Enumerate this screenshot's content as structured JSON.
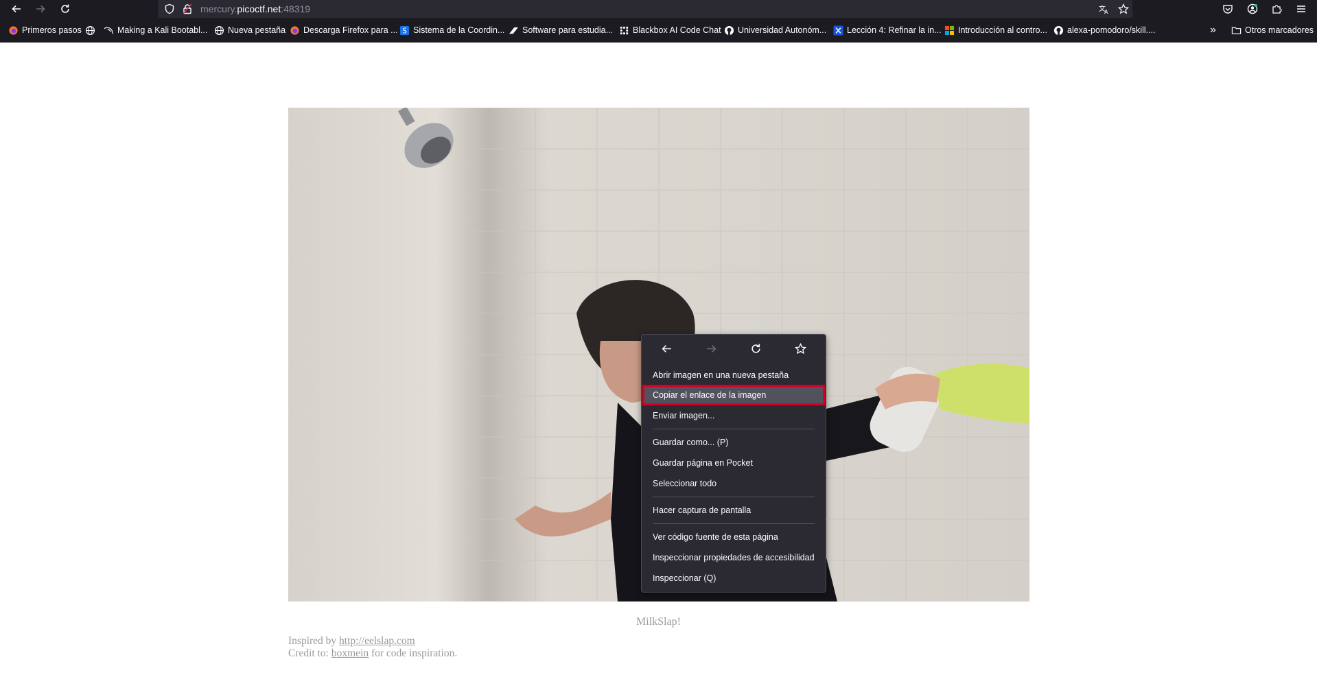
{
  "browser": {
    "url_prefix": "mercury.",
    "url_domain": "picoctf.net",
    "url_suffix": ":48319",
    "bookmarks": [
      {
        "label": "Primeros pasos",
        "icon": "firefox-icon"
      },
      {
        "label": "",
        "icon": "globe-icon"
      },
      {
        "label": "Making a Kali Bootabl...",
        "icon": "kali-icon"
      },
      {
        "label": "Nueva pestaña",
        "icon": "globe-icon"
      },
      {
        "label": "Descarga Firefox para ...",
        "icon": "firefox-icon"
      },
      {
        "label": "Sistema de la Coordin...",
        "icon": "s-logo-icon"
      },
      {
        "label": "Software para estudia...",
        "icon": "software-logo-icon"
      },
      {
        "label": "Blackbox AI Code Chat",
        "icon": "blackbox-icon"
      },
      {
        "label": "Universidad Autonóm...",
        "icon": "github-icon"
      },
      {
        "label": "Lección 4: Refinar la in...",
        "icon": "x-logo-icon"
      },
      {
        "label": "Introducción al contro...",
        "icon": "microsoft-icon"
      },
      {
        "label": "alexa-pomodoro/skill....",
        "icon": "github-icon"
      }
    ],
    "overflow_label": "»",
    "other_bookmarks": "Otros marcadores"
  },
  "page": {
    "caption": "MilkSlap!",
    "inspired_prefix": "Inspired by ",
    "inspired_link": "http://eelslap.com",
    "credit_prefix": "Credit to: ",
    "credit_link": "boxmein",
    "credit_suffix": " for code inspiration."
  },
  "context_menu": {
    "nav_icons": [
      "back-icon",
      "forward-icon",
      "reload-icon",
      "bookmark-star-icon"
    ],
    "items": [
      {
        "label": "Abrir imagen en una nueva pestaña",
        "highlighted": false
      },
      {
        "label": "Copiar el enlace de la imagen",
        "highlighted": true
      },
      {
        "label": "Enviar imagen...",
        "highlighted": false
      },
      {
        "label": "Guardar como... (P)",
        "highlighted": false
      },
      {
        "label": "Guardar página en Pocket",
        "highlighted": false
      },
      {
        "label": "Seleccionar todo",
        "highlighted": false
      },
      {
        "label": "Hacer captura de pantalla",
        "highlighted": false
      },
      {
        "label": "Ver código fuente de esta página",
        "highlighted": false
      },
      {
        "label": "Inspeccionar propiedades de accesibilidad",
        "highlighted": false
      },
      {
        "label": "Inspeccionar (Q)",
        "highlighted": false
      }
    ]
  },
  "colors": {
    "chrome_bg": "#1c1b22",
    "urlbar_bg": "#2b2a33",
    "menu_bg": "#2b2a33",
    "highlight_outline": "#d70022",
    "page_text": "#9a9a9a"
  }
}
